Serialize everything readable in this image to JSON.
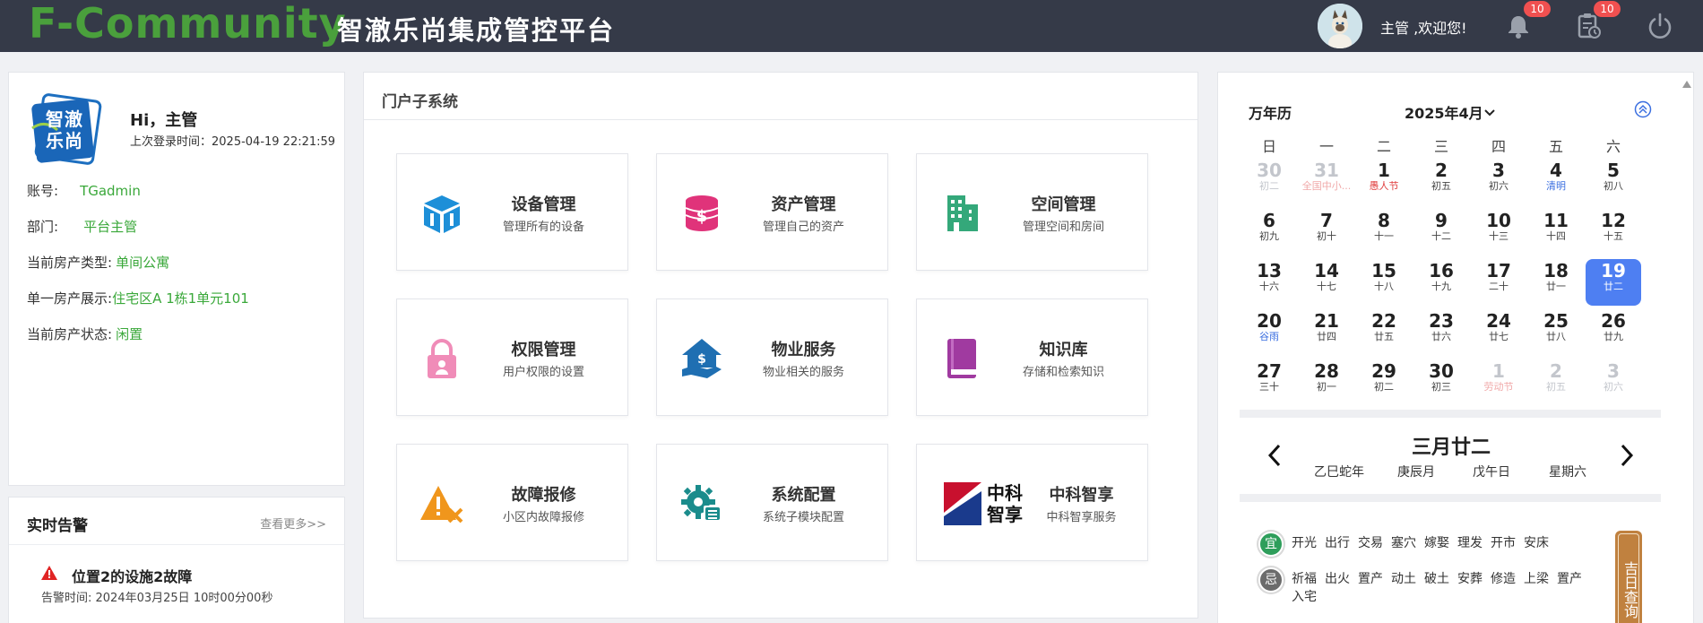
{
  "header": {
    "brand": "F-Community",
    "title": "智澈乐尚集成管控平台",
    "welcome": "主管 ,欢迎您!",
    "notification_count": "10",
    "task_count": "10"
  },
  "profile": {
    "logo_text": "智澈乐尚",
    "greeting": "Hi，主管",
    "last_login": "上次登录时间：2025-04-19 22:21:59",
    "rows": [
      {
        "label": "账号:",
        "value": "TGadmin"
      },
      {
        "label": "部门:",
        "value": "平台主管"
      },
      {
        "label": "当前房产类型:",
        "value": "单间公寓"
      },
      {
        "label": "单一房产展示:",
        "value": "住宅区A 1栋1单元101"
      },
      {
        "label": "当前房产状态:",
        "value": "闲置"
      }
    ]
  },
  "alerts": {
    "title": "实时告警",
    "more": "查看更多>>",
    "items": [
      {
        "text": "位置2的设施2故障",
        "time": "告警时间:   2024年03月25日 10时00分00秒"
      }
    ]
  },
  "portal": {
    "title": "门户子系统",
    "tiles": [
      {
        "name": "设备管理",
        "desc": "管理所有的设备",
        "icon": "cube-icon",
        "color": "#1d8fd8"
      },
      {
        "name": "资产管理",
        "desc": "管理自己的资产",
        "icon": "coins-icon",
        "color": "#e0337a"
      },
      {
        "name": "空间管理",
        "desc": "管理空间和房间",
        "icon": "building-icon",
        "color": "#34a87a"
      },
      {
        "name": "权限管理",
        "desc": "用户权限的设置",
        "icon": "lock-icon",
        "color": "#f08cb8"
      },
      {
        "name": "物业服务",
        "desc": "物业相关的服务",
        "icon": "house-hand-icon",
        "color": "#1f6fb2"
      },
      {
        "name": "知识库",
        "desc": "存储和检索知识",
        "icon": "book-icon",
        "color": "#a03aa0"
      },
      {
        "name": "故障报修",
        "desc": "小区内故障报修",
        "icon": "warning-wrench-icon",
        "color": "#f0961c"
      },
      {
        "name": "系统配置",
        "desc": "系统子模块配置",
        "icon": "gear-list-icon",
        "color": "#1a8c8c"
      },
      {
        "name": "中科智享",
        "desc": "中科智享服务",
        "icon": "zhongke-logo",
        "logo_text": "中科智享",
        "color": "#c8102e"
      }
    ]
  },
  "calendar": {
    "label": "万年历",
    "month": "2025年4月",
    "weekdays": [
      "日",
      "一",
      "二",
      "三",
      "四",
      "五",
      "六"
    ],
    "days": [
      {
        "n": "30",
        "s": "初二",
        "other": true
      },
      {
        "n": "31",
        "s": "全国中小...",
        "other": true,
        "fest": true
      },
      {
        "n": "1",
        "s": "愚人节",
        "fest": true
      },
      {
        "n": "2",
        "s": "初五"
      },
      {
        "n": "3",
        "s": "初六"
      },
      {
        "n": "4",
        "s": "清明",
        "term": true
      },
      {
        "n": "5",
        "s": "初八"
      },
      {
        "n": "6",
        "s": "初九"
      },
      {
        "n": "7",
        "s": "初十"
      },
      {
        "n": "8",
        "s": "十一"
      },
      {
        "n": "9",
        "s": "十二"
      },
      {
        "n": "10",
        "s": "十三"
      },
      {
        "n": "11",
        "s": "十四"
      },
      {
        "n": "12",
        "s": "十五"
      },
      {
        "n": "13",
        "s": "十六"
      },
      {
        "n": "14",
        "s": "十七"
      },
      {
        "n": "15",
        "s": "十八"
      },
      {
        "n": "16",
        "s": "十九"
      },
      {
        "n": "17",
        "s": "二十"
      },
      {
        "n": "18",
        "s": "廿一"
      },
      {
        "n": "19",
        "s": "廿二",
        "today": true
      },
      {
        "n": "20",
        "s": "谷雨",
        "term": true
      },
      {
        "n": "21",
        "s": "廿四"
      },
      {
        "n": "22",
        "s": "廿五"
      },
      {
        "n": "23",
        "s": "廿六"
      },
      {
        "n": "24",
        "s": "廿七"
      },
      {
        "n": "25",
        "s": "廿八"
      },
      {
        "n": "26",
        "s": "廿九"
      },
      {
        "n": "27",
        "s": "三十"
      },
      {
        "n": "28",
        "s": "初一"
      },
      {
        "n": "29",
        "s": "初二"
      },
      {
        "n": "30",
        "s": "初三"
      },
      {
        "n": "1",
        "s": "劳动节",
        "other": true,
        "fest": true
      },
      {
        "n": "2",
        "s": "初五",
        "other": true
      },
      {
        "n": "3",
        "s": "初六",
        "other": true
      }
    ],
    "lunar_date": "三月廿二",
    "ganzhi": [
      "乙巳蛇年",
      "庚辰月",
      "戊午日",
      "星期六"
    ],
    "yi_label": "宜",
    "yi": [
      "开光",
      "出行",
      "交易",
      "塞穴",
      "嫁娶",
      "理发",
      "开市",
      "安床"
    ],
    "ji_label": "忌",
    "ji": [
      "祈福",
      "出火",
      "置产",
      "动土",
      "破土",
      "安葬",
      "修造",
      "上梁",
      "置产",
      "入宅"
    ],
    "ji_query": "吉日查询",
    "yi_color": "#2e9e5b",
    "ji_color": "#6b6b6b",
    "today_color": "#4e7ff2"
  }
}
